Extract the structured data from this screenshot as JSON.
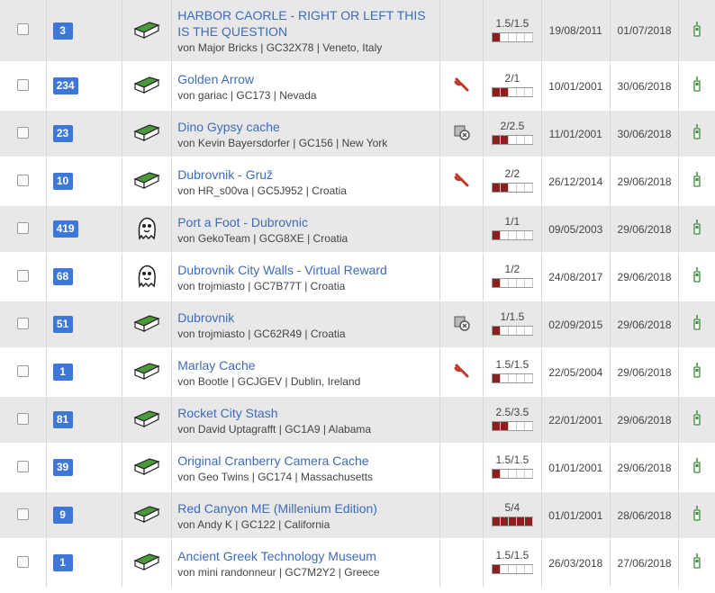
{
  "colors": {
    "accent": "#3d77d8",
    "link": "#3d6bb8",
    "row_alt": "#e8e8e8",
    "diff_fill": "#8a1f1f",
    "maint": "#c0392b",
    "gps": "#3a8a3a"
  },
  "rows": [
    {
      "favs": "3",
      "type": "traditional",
      "title": "HARBOR CAORLE - RIGHT OR LEFT THIS IS THE QUESTION",
      "owner": "von Major Bricks",
      "code": "GC32X78",
      "location": "Veneto, Italy",
      "attr": "",
      "dt": "1.5/1.5",
      "diff": 0.3,
      "terr": 0.3,
      "placed": "19/08/2011",
      "found": "01/07/2018"
    },
    {
      "favs": "234",
      "type": "traditional",
      "title": "Golden Arrow",
      "owner": "von gariac",
      "code": "GC173",
      "location": "Nevada",
      "attr": "wrench-icon",
      "dt": "2/1",
      "diff": 0.4,
      "terr": 0.2,
      "placed": "10/01/2001",
      "found": "30/06/2018"
    },
    {
      "favs": "23",
      "type": "traditional",
      "title": "Dino Gypsy cache",
      "owner": "von Kevin Bayersdorfer",
      "code": "GC156",
      "location": "New York",
      "attr": "event-icon",
      "dt": "2/2.5",
      "diff": 0.4,
      "terr": 0.5,
      "placed": "11/01/2001",
      "found": "30/06/2018"
    },
    {
      "favs": "10",
      "type": "traditional",
      "title": "Dubrovnik - Gruž",
      "owner": "von HR_s00va",
      "code": "GC5J952",
      "location": "Croatia",
      "attr": "wrench-icon",
      "dt": "2/2",
      "diff": 0.4,
      "terr": 0.4,
      "placed": "26/12/2014",
      "found": "29/06/2018"
    },
    {
      "favs": "419",
      "type": "virtual",
      "title": "Port a Foot - Dubrovnic",
      "owner": "von GekoTeam",
      "code": "GCG8XE",
      "location": "Croatia",
      "attr": "",
      "dt": "1/1",
      "diff": 0.2,
      "terr": 0.2,
      "placed": "09/05/2003",
      "found": "29/06/2018"
    },
    {
      "favs": "68",
      "type": "virtual",
      "title": "Dubrovnik City Walls - Virtual Reward",
      "owner": "von trojmiasto",
      "code": "GC7B77T",
      "location": "Croatia",
      "attr": "",
      "dt": "1/2",
      "diff": 0.2,
      "terr": 0.4,
      "placed": "24/08/2017",
      "found": "29/06/2018"
    },
    {
      "favs": "51",
      "type": "traditional",
      "title": "Dubrovnik",
      "owner": "von trojmiasto",
      "code": "GC62R49",
      "location": "Croatia",
      "attr": "event-icon",
      "dt": "1/1.5",
      "diff": 0.2,
      "terr": 0.3,
      "placed": "02/09/2015",
      "found": "29/06/2018"
    },
    {
      "favs": "1",
      "type": "traditional",
      "title": "Marlay Cache",
      "owner": "von Bootle",
      "code": "GCJGEV",
      "location": "Dublin, Ireland",
      "attr": "wrench-icon",
      "dt": "1.5/1.5",
      "diff": 0.3,
      "terr": 0.3,
      "placed": "22/05/2004",
      "found": "29/06/2018"
    },
    {
      "favs": "81",
      "type": "traditional",
      "title": "Rocket City Stash",
      "owner": "von David Uptagrafft",
      "code": "GC1A9",
      "location": "Alabama",
      "attr": "",
      "dt": "2.5/3.5",
      "diff": 0.5,
      "terr": 0.7,
      "placed": "22/01/2001",
      "found": "29/06/2018"
    },
    {
      "favs": "39",
      "type": "traditional",
      "title": "Original Cranberry Camera Cache",
      "owner": "von Geo Twins",
      "code": "GC174",
      "location": "Massachusetts",
      "attr": "",
      "dt": "1.5/1.5",
      "diff": 0.3,
      "terr": 0.3,
      "placed": "01/01/2001",
      "found": "29/06/2018"
    },
    {
      "favs": "9",
      "type": "traditional",
      "title": "Red Canyon ME (Millenium Edition)",
      "owner": "von Andy K",
      "code": "GC122",
      "location": "California",
      "attr": "",
      "dt": "5/4",
      "diff": 1.0,
      "terr": 0.8,
      "placed": "01/01/2001",
      "found": "28/06/2018"
    },
    {
      "favs": "1",
      "type": "traditional",
      "title": "Ancient Greek Technology Museum",
      "owner": "von mini randonneur",
      "code": "GC7M2Y2",
      "location": "Greece",
      "attr": "",
      "dt": "1.5/1.5",
      "diff": 0.3,
      "terr": 0.3,
      "placed": "26/03/2018",
      "found": "27/06/2018"
    }
  ]
}
